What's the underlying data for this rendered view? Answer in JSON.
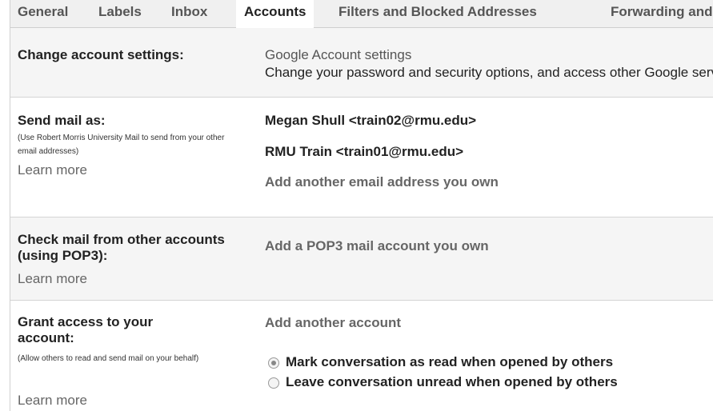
{
  "tabs": [
    "General",
    "Labels",
    "Inbox",
    "Accounts",
    "Filters and Blocked Addresses",
    "Forwarding and POP/IMAP"
  ],
  "active_tab": "Accounts",
  "change_account": {
    "label": "Change account settings:",
    "link": "Google Account settings",
    "desc": "Change your password and security options, and access other Google services."
  },
  "send_mail": {
    "label": "Send mail as:",
    "note": "(Use Robert Morris University Mail to send from your other email addresses)",
    "learn_more": "Learn more",
    "addresses": [
      "Megan Shull <train02@rmu.edu>",
      "RMU Train <train01@rmu.edu>"
    ],
    "add_link": "Add another email address you own"
  },
  "check_mail": {
    "label": "Check mail from other accounts (using POP3):",
    "learn_more": "Learn more",
    "add_link": "Add a POP3 mail account you own"
  },
  "grant_access": {
    "label": "Grant access to your account:",
    "note": "(Allow others to read and send mail on your behalf)",
    "learn_more": "Learn more",
    "add_link": "Add another account",
    "options": [
      "Mark conversation as read when opened by others",
      "Leave conversation unread when opened by others"
    ],
    "selected_option": 0
  }
}
